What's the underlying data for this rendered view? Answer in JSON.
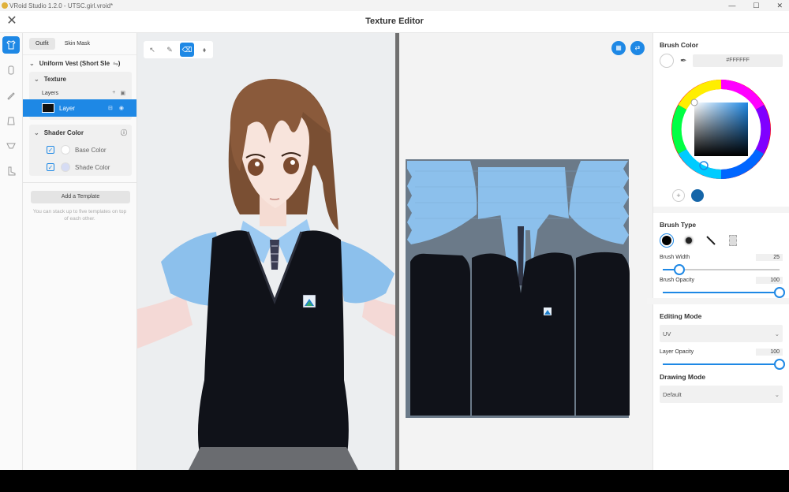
{
  "os": {
    "title": "VRoid Studio 1.2.0 - UTSC.girl.vroid*",
    "min": "—",
    "max": "☐",
    "close": "✕"
  },
  "header": {
    "title": "Texture Editor",
    "close_label": "✕"
  },
  "rail": [
    {
      "name": "rail-outfit-icon",
      "glyph": "👕",
      "active": true
    },
    {
      "name": "rail-body-icon",
      "glyph": "▯",
      "active": false
    },
    {
      "name": "rail-accessory-icon",
      "glyph": "✎",
      "active": false
    },
    {
      "name": "rail-top-icon",
      "glyph": "▱",
      "active": false
    },
    {
      "name": "rail-bra-icon",
      "glyph": "▽",
      "active": false
    },
    {
      "name": "rail-shoe-icon",
      "glyph": "▙",
      "active": false
    }
  ],
  "left": {
    "tabs": [
      "Outfit",
      "Skin Mask"
    ],
    "garment": "Uniform Vest (Short Sle",
    "garment_suffix": ")",
    "texture_section": "Texture",
    "layers_label": "Layers",
    "layer_name": "Layer",
    "shader_section": "Shader Color",
    "shader_rows": [
      {
        "label": "Base Color",
        "color": "#ffffff"
      },
      {
        "label": "Shade Color",
        "color": "#d6dcf4"
      }
    ],
    "template_button": "Add a Template",
    "template_note": "You can stack up to five templates on top of each other."
  },
  "viewport": {
    "tools": [
      "select-tool",
      "pen-tool",
      "eraser-tool",
      "fill-tool"
    ],
    "active_tool": 2
  },
  "right": {
    "brush_color_title": "Brush Color",
    "hex": "#FFFFFF",
    "recent_colors": [
      "#1565a8"
    ],
    "brush_type_title": "Brush Type",
    "brush_width_label": "Brush Width",
    "brush_width": 25,
    "brush_opacity_label": "Brush Opacity",
    "brush_opacity": 100,
    "editing_mode_title": "Editing Mode",
    "editing_mode": "UV",
    "layer_opacity_label": "Layer Opacity",
    "layer_opacity": 100,
    "drawing_mode_title": "Drawing Mode",
    "drawing_mode": "Default"
  },
  "colors": {
    "accent": "#1e88e5",
    "vest": "#101219",
    "shirt": "#8cc0ec",
    "uv_bg": "#6b7a89"
  }
}
